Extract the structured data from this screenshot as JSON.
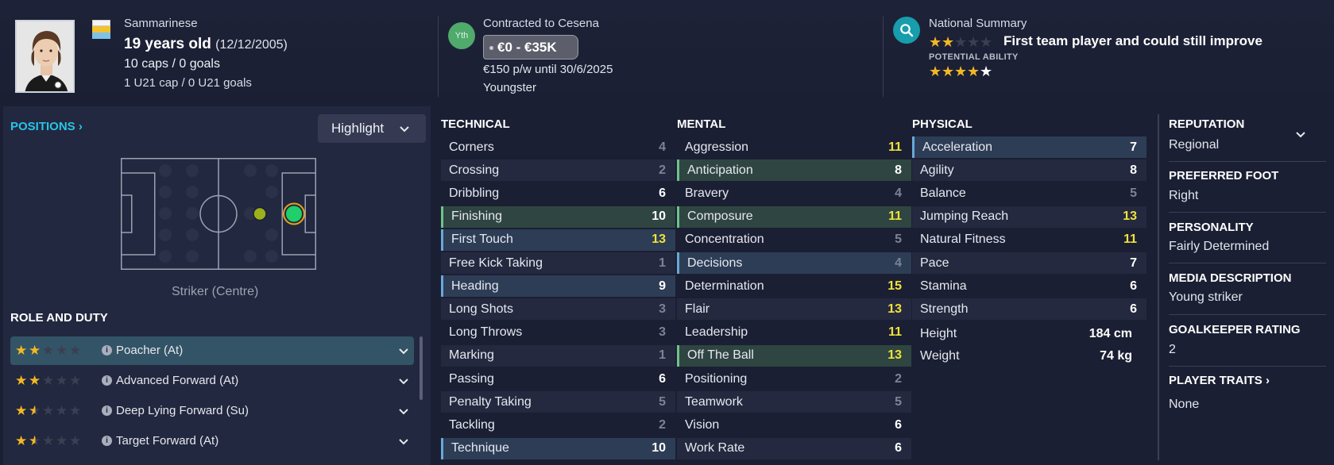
{
  "header": {
    "nationality": "Sammarinese",
    "age": "19 years old",
    "dob": "(12/12/2005)",
    "caps": "10 caps / 0 goals",
    "u21": "1 U21 cap / 0 U21 goals",
    "youth_badge": "Yth",
    "contract": "Contracted to Cesena",
    "value": "€0 - €35K",
    "wage": "€150 p/w until 30/6/2025",
    "status": "Youngster",
    "national_summary_label": "National Summary",
    "national_summary_text": "First team player and could still improve",
    "current_ability_stars": 2,
    "potential_ability_label": "POTENTIAL ABILITY",
    "potential_ability_stars": 4.5
  },
  "positions": {
    "title": "POSITIONS",
    "highlight_label": "Highlight",
    "position_label": "Striker (Centre)"
  },
  "roles": {
    "title": "ROLE AND DUTY",
    "items": [
      {
        "label": "Poacher (At)",
        "stars": 2,
        "selected": true
      },
      {
        "label": "Advanced Forward (At)",
        "stars": 2,
        "selected": false
      },
      {
        "label": "Deep Lying Forward (Su)",
        "stars": 1.5,
        "selected": false
      },
      {
        "label": "Target Forward (At)",
        "stars": 1.5,
        "selected": false
      }
    ]
  },
  "technical": {
    "title": "TECHNICAL",
    "items": [
      {
        "name": "Corners",
        "value": "4",
        "color": "gray",
        "hl": ""
      },
      {
        "name": "Crossing",
        "value": "2",
        "color": "gray",
        "hl": ""
      },
      {
        "name": "Dribbling",
        "value": "6",
        "color": "white",
        "hl": ""
      },
      {
        "name": "Finishing",
        "value": "10",
        "color": "white",
        "hl": "green"
      },
      {
        "name": "First Touch",
        "value": "13",
        "color": "yellow",
        "hl": "blue"
      },
      {
        "name": "Free Kick Taking",
        "value": "1",
        "color": "gray",
        "hl": ""
      },
      {
        "name": "Heading",
        "value": "9",
        "color": "white",
        "hl": "blue"
      },
      {
        "name": "Long Shots",
        "value": "3",
        "color": "gray",
        "hl": ""
      },
      {
        "name": "Long Throws",
        "value": "3",
        "color": "gray",
        "hl": ""
      },
      {
        "name": "Marking",
        "value": "1",
        "color": "gray",
        "hl": ""
      },
      {
        "name": "Passing",
        "value": "6",
        "color": "white",
        "hl": ""
      },
      {
        "name": "Penalty Taking",
        "value": "5",
        "color": "gray",
        "hl": ""
      },
      {
        "name": "Tackling",
        "value": "2",
        "color": "gray",
        "hl": ""
      },
      {
        "name": "Technique",
        "value": "10",
        "color": "white",
        "hl": "blue"
      }
    ]
  },
  "mental": {
    "title": "MENTAL",
    "items": [
      {
        "name": "Aggression",
        "value": "11",
        "color": "yellow",
        "hl": ""
      },
      {
        "name": "Anticipation",
        "value": "8",
        "color": "white",
        "hl": "green"
      },
      {
        "name": "Bravery",
        "value": "4",
        "color": "gray",
        "hl": ""
      },
      {
        "name": "Composure",
        "value": "11",
        "color": "yellow",
        "hl": "green"
      },
      {
        "name": "Concentration",
        "value": "5",
        "color": "gray",
        "hl": ""
      },
      {
        "name": "Decisions",
        "value": "4",
        "color": "gray",
        "hl": "blue"
      },
      {
        "name": "Determination",
        "value": "15",
        "color": "yellow",
        "hl": ""
      },
      {
        "name": "Flair",
        "value": "13",
        "color": "yellow",
        "hl": ""
      },
      {
        "name": "Leadership",
        "value": "11",
        "color": "yellow",
        "hl": ""
      },
      {
        "name": "Off The Ball",
        "value": "13",
        "color": "yellow",
        "hl": "green"
      },
      {
        "name": "Positioning",
        "value": "2",
        "color": "gray",
        "hl": ""
      },
      {
        "name": "Teamwork",
        "value": "5",
        "color": "gray",
        "hl": ""
      },
      {
        "name": "Vision",
        "value": "6",
        "color": "white",
        "hl": ""
      },
      {
        "name": "Work Rate",
        "value": "6",
        "color": "white",
        "hl": ""
      }
    ]
  },
  "physical": {
    "title": "PHYSICAL",
    "items": [
      {
        "name": "Acceleration",
        "value": "7",
        "color": "white",
        "hl": "blue"
      },
      {
        "name": "Agility",
        "value": "8",
        "color": "white",
        "hl": ""
      },
      {
        "name": "Balance",
        "value": "5",
        "color": "gray",
        "hl": ""
      },
      {
        "name": "Jumping Reach",
        "value": "13",
        "color": "yellow",
        "hl": ""
      },
      {
        "name": "Natural Fitness",
        "value": "11",
        "color": "yellow",
        "hl": ""
      },
      {
        "name": "Pace",
        "value": "7",
        "color": "white",
        "hl": ""
      },
      {
        "name": "Stamina",
        "value": "6",
        "color": "white",
        "hl": ""
      },
      {
        "name": "Strength",
        "value": "6",
        "color": "white",
        "hl": ""
      }
    ],
    "height_label": "Height",
    "height_value": "184 cm",
    "weight_label": "Weight",
    "weight_value": "74 kg"
  },
  "info": {
    "reputation_label": "REPUTATION",
    "reputation_value": "Regional",
    "foot_label": "PREFERRED FOOT",
    "foot_value": "Right",
    "personality_label": "PERSONALITY",
    "personality_value": "Fairly Determined",
    "media_label": "MEDIA DESCRIPTION",
    "media_value": "Young striker",
    "gk_label": "GOALKEEPER RATING",
    "gk_value": "2",
    "traits_label": "PLAYER TRAITS",
    "traits_value": "None"
  }
}
